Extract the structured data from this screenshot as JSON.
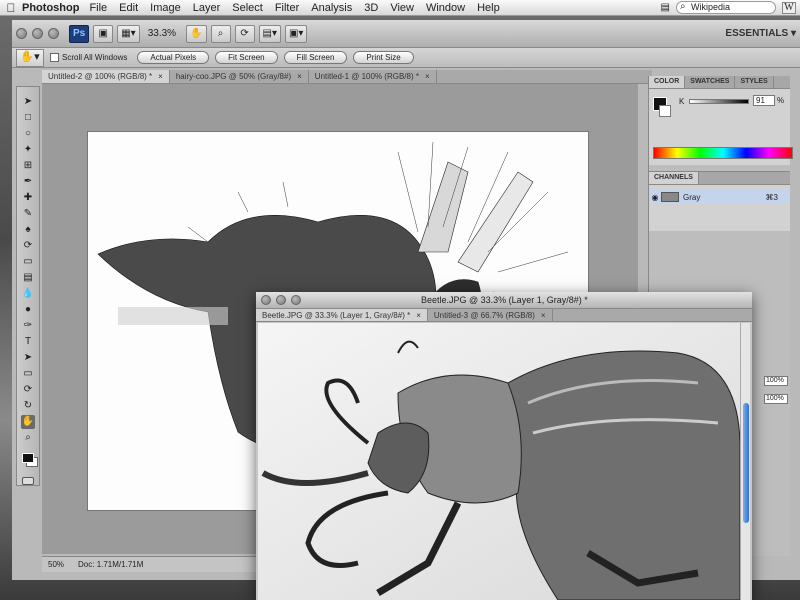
{
  "menubar": {
    "app_name": "Photoshop",
    "items": [
      "File",
      "Edit",
      "Image",
      "Layer",
      "Select",
      "Filter",
      "Analysis",
      "3D",
      "View",
      "Window",
      "Help"
    ],
    "search_value": "Wikipedia",
    "search_button": "W"
  },
  "app": {
    "ps_logo": "Ps",
    "zoom": "33.3%",
    "workspace": "ESSENTIALS ▾"
  },
  "options": {
    "scroll_all_windows": "Scroll All Windows",
    "buttons": [
      "Actual Pixels",
      "Fit Screen",
      "Fill Screen",
      "Print Size"
    ]
  },
  "doc_tabs": [
    "Untitled-2 @ 100% (RGB/8) *",
    "hairy-coo.JPG @ 50% (Gray/8#)",
    "Untitled-1 @ 100% (RGB/8) *"
  ],
  "status": {
    "zoom": "50%",
    "doc": "Doc: 1.71M/1.71M"
  },
  "panels": {
    "color_tabs": [
      "COLOR",
      "SWATCHES",
      "STYLES"
    ],
    "k_label": "K",
    "k_value": "91",
    "k_unit": "%",
    "channels_title": "CHANNELS",
    "channel_name": "Gray",
    "channel_shortcut": "⌘3",
    "opacity_1": "100%",
    "opacity_2": "100%"
  },
  "window2": {
    "title": "Beetle.JPG @ 33.3% (Layer 1, Gray/8#) *",
    "tabs": [
      "Beetle.JPG @ 33.3% (Layer 1, Gray/8#) *",
      "Untitled-3 @ 66.7% (RGB/8)"
    ]
  },
  "colors": {
    "accent": "#2f6fcf",
    "ps_logo_bg": "#1e3d7a"
  }
}
